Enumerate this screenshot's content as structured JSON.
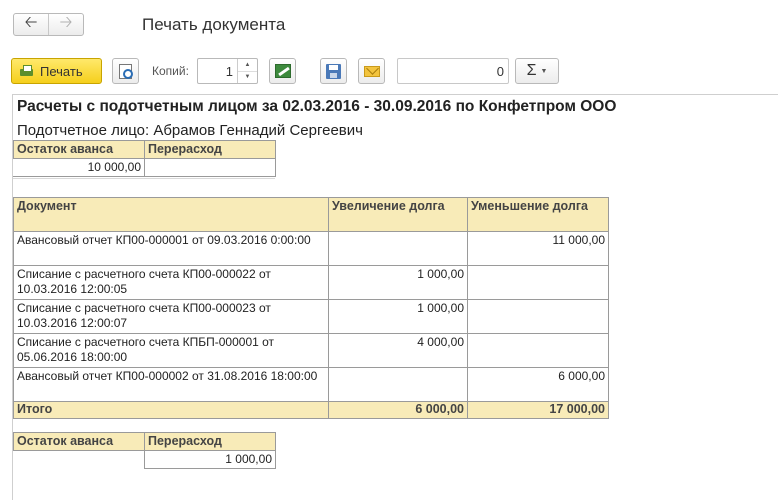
{
  "window": {
    "title": "Печать документа",
    "back_icon": "arrow-left-icon",
    "forward_icon": "arrow-right-icon"
  },
  "toolbar": {
    "print_label": "Печать",
    "copies_label": "Копий:",
    "copies_value": "1",
    "sum_value": "0",
    "sigma_label": "Σ"
  },
  "colors": {
    "print_button": "#f5cf1c",
    "table_header": "#f8ebb8"
  },
  "report": {
    "title": "Расчеты с подотчетным лицом за 02.03.2016 - 30.09.2016 по Конфетпром ООО",
    "subtitle": "Подотчетное лицо: Абрамов Геннадий Сергеевич",
    "opening": {
      "headers": [
        "Остаток аванса",
        "Перерасход"
      ],
      "values": [
        "10 000,00",
        ""
      ]
    },
    "main": {
      "headers": [
        "Документ",
        "Увеличение долга",
        "Уменьшение долга"
      ],
      "rows": [
        {
          "doc": "Авансовый отчет КП00-000001 от 09.03.2016 0:00:00",
          "inc": "",
          "dec": "11 000,00"
        },
        {
          "doc": "Списание с расчетного счета КП00-000022 от 10.03.2016 12:00:05",
          "inc": "1 000,00",
          "dec": ""
        },
        {
          "doc": "Списание с расчетного счета КП00-000023 от 10.03.2016 12:00:07",
          "inc": "1 000,00",
          "dec": ""
        },
        {
          "doc": "Списание с расчетного счета КПБП-000001 от 05.06.2016 18:00:00",
          "inc": "4 000,00",
          "dec": ""
        },
        {
          "doc": "Авансовый отчет КП00-000002 от 31.08.2016 18:00:00",
          "inc": "",
          "dec": "6 000,00"
        }
      ],
      "total": {
        "label": "Итого",
        "inc": "6 000,00",
        "dec": "17 000,00"
      }
    },
    "closing": {
      "headers": [
        "Остаток аванса",
        "Перерасход"
      ],
      "values": [
        "",
        "1 000,00"
      ]
    }
  }
}
